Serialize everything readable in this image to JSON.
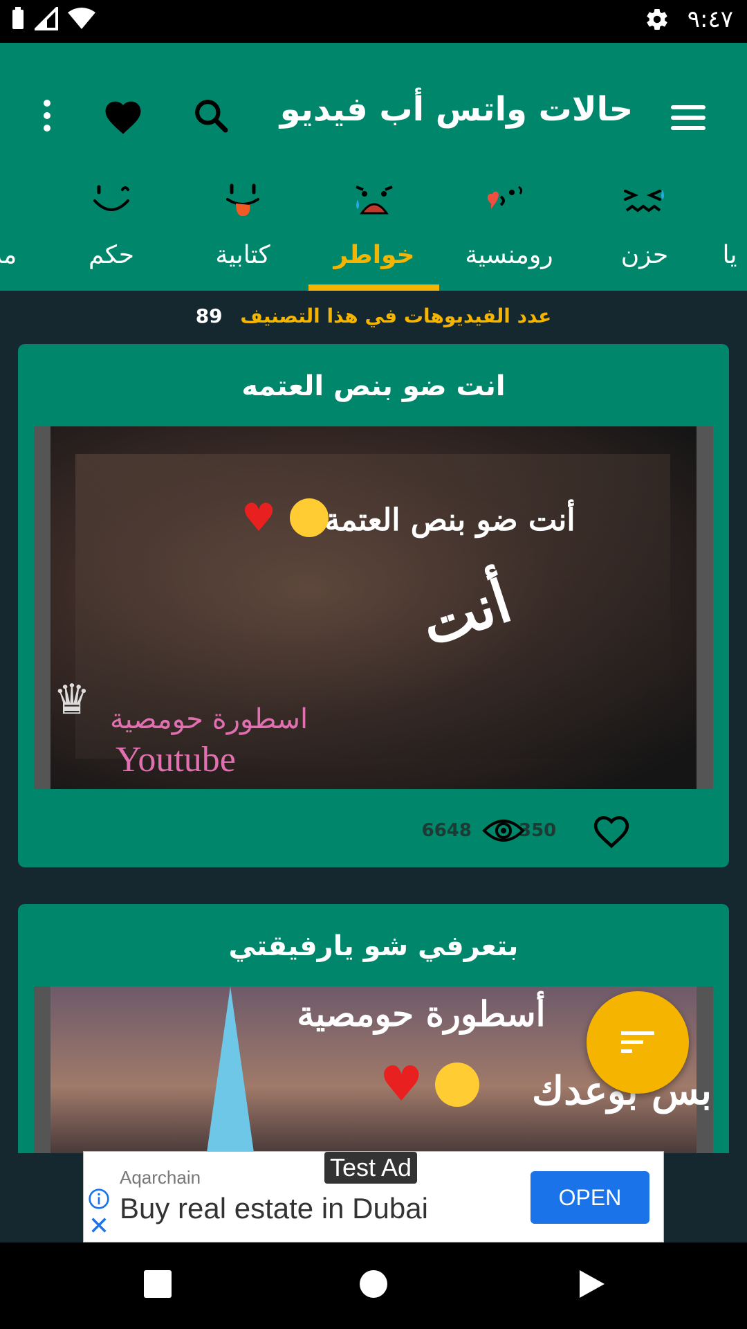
{
  "status_bar": {
    "time": "٩:٤٧"
  },
  "app_bar": {
    "title": "حالات واتس أب فيديو"
  },
  "tabs": [
    {
      "label": "يا",
      "icon": "partial-emoji-icon"
    },
    {
      "label": "حزن",
      "icon": "crying-face-icon"
    },
    {
      "label": "رومنسية",
      "icon": "heart-kiss-face-icon"
    },
    {
      "label": "خواطر",
      "icon": "sad-face-icon"
    },
    {
      "label": "كتابية",
      "icon": "tongue-face-icon"
    },
    {
      "label": "حكم",
      "icon": "smiling-face-icon"
    },
    {
      "label": "مة",
      "icon": "partial-emoji-icon"
    }
  ],
  "active_tab": "خواطر",
  "counter": {
    "label": "عدد الفيديوهات في هذا التصنيف",
    "value": "89"
  },
  "cards": [
    {
      "title": "انت ضو بنص العتمه",
      "thumb_overlay": {
        "line1": "أنت ضو بنص العتمة\"",
        "line2": "أنت",
        "watermark": "اسطورة حومصية",
        "brand": "Youtube"
      },
      "likes": "350",
      "views": "6648"
    },
    {
      "title": "بتعرفي شو يارفيقتي",
      "thumb_overlay": {
        "line1": "أسطورة حومصية",
        "line2": "بس بوعدك"
      }
    }
  ],
  "ad": {
    "badge": "Test Ad",
    "advertiser": "Aqarchain",
    "text": "Buy real estate in Dubai",
    "cta": "OPEN"
  },
  "colors": {
    "primary": "#00866a",
    "accent": "#f4b400",
    "background": "#16282f",
    "ad_button": "#1a73e8"
  }
}
